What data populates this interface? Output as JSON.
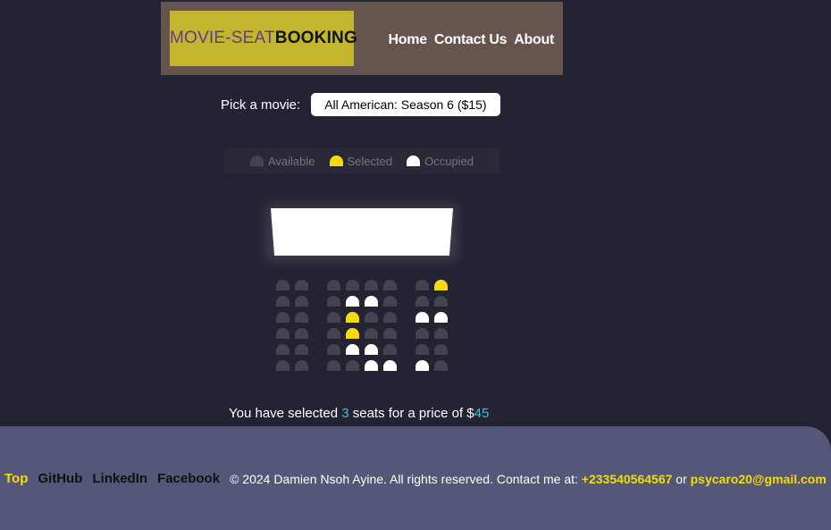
{
  "header": {
    "logo_part1": "MOVIE-SEAT",
    "logo_part2": "BOOKING",
    "nav": [
      "Home",
      "Contact Us",
      "About"
    ]
  },
  "picker": {
    "label": "Pick a movie:",
    "selected": "All American: Season 6 ($15)"
  },
  "legend": {
    "available": "Available",
    "selected": "Selected",
    "occupied": "Occupied"
  },
  "seats": {
    "rows": [
      [
        "a",
        "a",
        "a",
        "a",
        "a",
        "a",
        "a",
        "s"
      ],
      [
        "a",
        "a",
        "a",
        "o",
        "o",
        "a",
        "a",
        "a"
      ],
      [
        "a",
        "a",
        "a",
        "s",
        "a",
        "a",
        "o",
        "o"
      ],
      [
        "a",
        "a",
        "a",
        "s",
        "a",
        "a",
        "a",
        "a"
      ],
      [
        "a",
        "a",
        "a",
        "o",
        "o",
        "a",
        "a",
        "a"
      ],
      [
        "a",
        "a",
        "a",
        "a",
        "o",
        "o",
        "o",
        "a"
      ]
    ]
  },
  "summary": {
    "prefix": "You have selected",
    "count": "3",
    "middle": "seats for a price of $",
    "total": "45"
  },
  "footer": {
    "top": "Top",
    "github": "GitHub",
    "linkedin": "LinkedIn",
    "facebook": "Facebook",
    "copyright": "© 2024 Damien Nsoh Ayine. All rights reserved. Contact me at:",
    "phone": "+233540564567",
    "or": "or",
    "email": "psycaro20@gmail.com"
  },
  "colors": {
    "background": "#242333",
    "selected": "#f6da10",
    "available": "#444451",
    "occupied": "#ffffff",
    "accent": "#3ec1d3"
  }
}
